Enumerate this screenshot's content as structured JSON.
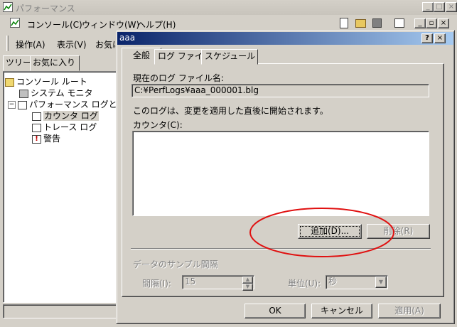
{
  "main_window": {
    "title": "パフォーマンス",
    "menu": [
      "コンソール(C)",
      "ウィンドウ(W)",
      "ヘルプ(H)"
    ],
    "toolbar": [
      "操作(A)",
      "表示(V)",
      "お気に"
    ],
    "tree_tabs": [
      "ツリー",
      "お気に入り"
    ],
    "tree": {
      "root": "コンソール ルート",
      "system_monitor": "システム モニタ",
      "perf_logs": "パフォーマンス ログと警告",
      "counter_log": "カウンタ ログ",
      "trace_log": "トレース ログ",
      "alert": "警告"
    }
  },
  "dialog": {
    "title": "aaa",
    "help_btn": "?",
    "close_btn": "×",
    "tabs": [
      "全般",
      "ログ ファイル",
      "スケジュール"
    ],
    "current_log_label": "現在のログ ファイル名:",
    "current_log_value": "C:¥PerfLogs¥aaa_000001.blg",
    "notice": "このログは、変更を適用した直後に開始されます。",
    "counters_label": "カウンタ(C):",
    "add_button": "追加(D)...",
    "remove_button": "削除(R)",
    "sample_interval_group": "データのサンプル間隔",
    "interval_label": "間隔(I):",
    "interval_value": "15",
    "unit_label": "単位(U):",
    "unit_value": "秒",
    "ok_button": "OK",
    "cancel_button": "キャンセル",
    "apply_button": "適用(A)"
  },
  "colors": {
    "titlebar_active_start": "#0a246a",
    "titlebar_active_end": "#a6caf0",
    "annotation_ellipse": "#e01010"
  }
}
